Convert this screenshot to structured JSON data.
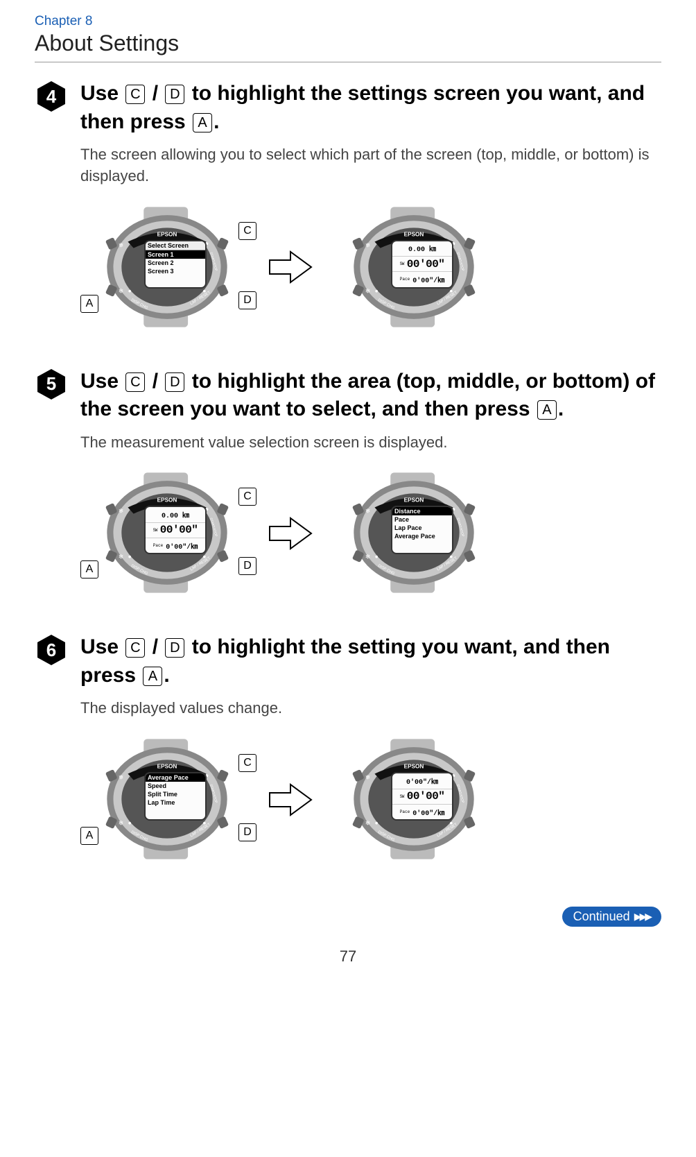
{
  "header": {
    "chapter": "Chapter 8",
    "section": "About Settings"
  },
  "steps": [
    {
      "number": "4",
      "title_pre": "Use ",
      "key1": "C",
      "title_mid1": " / ",
      "key2": "D",
      "title_mid2": " to highlight the settings screen you want, and then press ",
      "key3": "A",
      "title_post": ".",
      "desc": "The screen allowing you to select which part of the screen (top, middle, or bottom) is displayed.",
      "watch1": {
        "type": "list",
        "header": "Select Screen",
        "items": [
          "Screen 1",
          "Screen 2",
          "Screen 3"
        ],
        "selected": 0,
        "labels": {
          "A": "A",
          "C": "C",
          "D": "D"
        }
      },
      "watch2": {
        "type": "three",
        "top_tag": "",
        "top": "0.00 ㎞",
        "mid_tag": "SW",
        "mid": "00'00\"",
        "bot_tag": "Pace",
        "bot": "0'00\"/㎞",
        "labels": null
      }
    },
    {
      "number": "5",
      "title_pre": "Use ",
      "key1": "C",
      "title_mid1": " / ",
      "key2": "D",
      "title_mid2": " to highlight the area (top, middle, or bottom) of the screen you want to select, and then press ",
      "key3": "A",
      "title_post": ".",
      "desc": "The measurement value selection screen is displayed.",
      "watch1": {
        "type": "three",
        "top_tag": "",
        "top": "0.00 ㎞",
        "mid_tag": "SW",
        "mid": "00'00\"",
        "bot_tag": "Pace",
        "bot": "0'00\"/㎞",
        "labels": {
          "A": "A",
          "C": "C",
          "D": "D"
        }
      },
      "watch2": {
        "type": "list",
        "header": "",
        "items": [
          "Distance",
          "Pace",
          "Lap Pace",
          "Average Pace"
        ],
        "selected": 0,
        "labels": null
      }
    },
    {
      "number": "6",
      "title_pre": "Use ",
      "key1": "C",
      "title_mid1": " / ",
      "key2": "D",
      "title_mid2": " to highlight the setting you want, and then press ",
      "key3": "A",
      "title_post": ".",
      "desc": "The displayed values change.",
      "watch1": {
        "type": "list",
        "header": "",
        "items": [
          "Average Pace",
          "Speed",
          "Split Time",
          "Lap Time"
        ],
        "selected": 0,
        "labels": {
          "A": "A",
          "C": "C",
          "D": "D"
        }
      },
      "watch2": {
        "type": "three",
        "top_tag": "",
        "top": "0'00\"/㎞",
        "mid_tag": "SW",
        "mid": "00'00\"",
        "bot_tag": "Pace",
        "bot": "0'00\"/㎞",
        "labels": null
      }
    }
  ],
  "continued": "Continued",
  "page": "77",
  "brand": "EPSON",
  "button_text": {
    "disp": "DISP CHG",
    "lap": "LAP / RESET",
    "start": "START/STOP"
  }
}
